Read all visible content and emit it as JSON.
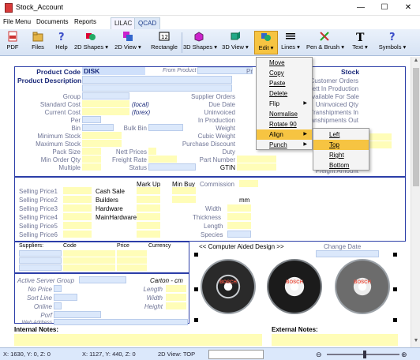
{
  "window": {
    "title": "Stock_Account",
    "minimize": "—",
    "maximize": "☐",
    "close": "✕"
  },
  "menubar": {
    "items": [
      "File Menu",
      "Documents",
      "Reports"
    ],
    "tabs": [
      "LILAC",
      "QCAD"
    ]
  },
  "toolbar": {
    "buttons": [
      "PDF",
      "Files",
      "Help",
      "2D Shapes ▾",
      "2D View ▾",
      "Rectangle",
      "3D Shapes ▾",
      "3D View ▾",
      "Edit ▾",
      "Lines ▾",
      "Pen & Brush ▾",
      "Text ▾",
      "Symbols ▾"
    ],
    "icons": [
      "pdf-icon",
      "files-icon",
      "help-icon",
      "shapes-2d-icon",
      "view-2d-icon",
      "rectangle-icon",
      "shapes-3d-icon",
      "view-3d-icon",
      "edit-icon",
      "lines-icon",
      "pen-brush-icon",
      "text-icon",
      "symbols-icon"
    ],
    "active": "Edit ▾"
  },
  "form": {
    "product_code_label": "Product Code",
    "product_code_value": "DISK",
    "from_product": "From Product",
    "pr_fragment": "Pr",
    "stock_label": "Stock",
    "product_description": "Product Description",
    "left_labels": [
      "Group",
      "Standard Cost",
      "Current Cost",
      "Per",
      "Bin",
      "Minimum Stock",
      "Maximum Stock",
      "Pack Size",
      "Min Order Qty",
      "Multiple"
    ],
    "local": "(local)",
    "forex": "(forex)",
    "bulk_bin": "Bulk Bin",
    "nett_prices": "Nett Prices",
    "freight_rate": "Freight Rate",
    "status": "Status",
    "mid_labels": [
      "Supplier Orders",
      "Due Date",
      "Uninvoiced",
      "In Production",
      "Weight",
      "Cubic Weight",
      "Purchase Discount",
      "Duty",
      "Part Number",
      "GTIN"
    ],
    "right_labels": [
      "Customer Orders",
      "Nett In Production",
      "Available For Sale",
      "Uninvoiced Qty",
      "Transhipments In",
      "Transhipments Out",
      "Freight Amount"
    ],
    "selling_prices": [
      "Selling Price1",
      "Selling Price2",
      "Selling Price3",
      "Selling Price4",
      "Selling Price5",
      "Selling Price6"
    ],
    "price_names": [
      "Cash Sale",
      "Builders",
      "Hardware",
      "MainHardware"
    ],
    "mark_up": "Mark Up",
    "min_buy": "Min Buy",
    "commission": "Commission",
    "mm": "mm",
    "dims": [
      "Width",
      "Thickness",
      "Length",
      "Species"
    ],
    "suppliers_header": [
      "Suppliers:",
      "Code",
      "Price",
      "Currency"
    ],
    "active_server_group": "Active Server Group",
    "carton": "Carton - cm",
    "server_labels": [
      "No Price",
      "Sort Line",
      "Online",
      "Porf",
      "Web Address"
    ],
    "carton_labels": [
      "Length",
      "Width",
      "Height"
    ],
    "cad_link": "<< Computer Aided Design >>",
    "change_date": "Change Date",
    "internal_notes": "Internal Notes:",
    "external_notes": "External Notes:",
    "disc_brand": "BOSCH"
  },
  "edit_menu": {
    "items": [
      "Move",
      "Copy",
      "Paste",
      "Delete",
      "Flip",
      "Normalise",
      "Rotate 90",
      "Align",
      "Punch"
    ],
    "submenu_markers": [
      "Flip",
      "Align",
      "Punch"
    ],
    "highlighted": "Align"
  },
  "align_submenu": {
    "items": [
      "Left",
      "Top",
      "Right",
      "Bottom"
    ],
    "highlighted": "Top"
  },
  "statusbar": {
    "coords1": "X: 1630, Y:    0, Z:    0",
    "coords2": "X: 1127, Y:   440, Z:    0",
    "view": "2D View: TOP"
  },
  "colors": {
    "accent": "#f6c442",
    "field_yellow": "#fffdb8",
    "field_blue": "#dbe8fb",
    "frame": "#2c3ea8"
  }
}
